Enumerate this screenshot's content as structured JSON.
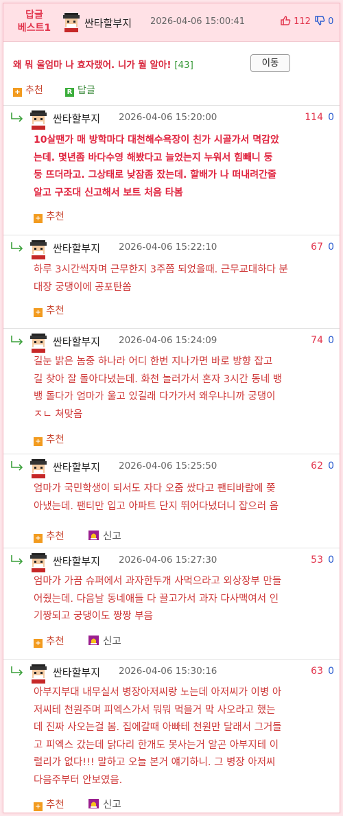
{
  "post": {
    "best_line1": "답글",
    "best_line2": "베스트1",
    "author": "싼타할부지",
    "date": "2026-04-06 15:00:41",
    "upvotes": "112",
    "downvotes": "0",
    "title": "왜 뭐 울엄마 나 효자랬어. 니가 뭘 알아!",
    "reply_count": "[43]",
    "move_button": "이동",
    "recommend_label": "추천",
    "reply_label": "답글"
  },
  "replies": [
    {
      "author": "싼타할부지",
      "date": "2026-04-06 15:20:00",
      "upvotes": "114",
      "downvotes": "0",
      "lines": [
        "10살땐가 매 방학마다 대천해수욕장이 친가 시골가서 멱감았",
        "는데. 몇년좀 바다수영 해봤다고 늘었는지 누워서 힘빼니 둥",
        "둥 뜨더라고. 그상태로 낮잠좀 잤는데. 할배가 나 떠내려간줄",
        "알고 구조대 신고해서 보트 처음 타봄"
      ],
      "recommend_label": "추천",
      "report_label": ""
    },
    {
      "author": "싼타할부지",
      "date": "2026-04-06 15:22:10",
      "upvotes": "67",
      "downvotes": "0",
      "lines": [
        "하루 3시간씩자며 근무한지 3주쯤 되었을때. 근무교대하다 분",
        "대장 궁댕이에 공포탄쏨"
      ],
      "recommend_label": "추천",
      "report_label": ""
    },
    {
      "author": "싼타할부지",
      "date": "2026-04-06 15:24:09",
      "upvotes": "74",
      "downvotes": "0",
      "lines": [
        "길눈 밝은 놈중 하나라 어디 한번 지나가면 바로 방향 잡고",
        "길 찾아 잘 돌아다녔는데. 화천 놀러가서 혼자 3시간 동네 뱅",
        "뱅 돌다가 엄마가 울고 있길래 다가가서 왜우냐니까 궁댕이",
        "ㅈㄴ 쳐맞음"
      ],
      "recommend_label": "추천",
      "report_label": ""
    },
    {
      "author": "싼타할부지",
      "date": "2026-04-06 15:25:50",
      "upvotes": "62",
      "downvotes": "0",
      "lines": [
        "엄마가 국민학생이 되서도 자다 오줌 쌌다고 팬티바람에 쫒",
        "아냈는데. 팬티만 입고 아파트 단지 뛰어다녔더니 잡으러 옴"
      ],
      "recommend_label": "추천",
      "report_label": "신고"
    },
    {
      "author": "싼타할부지",
      "date": "2026-04-06 15:27:30",
      "upvotes": "53",
      "downvotes": "0",
      "lines": [
        "엄마가 가끔 슈퍼에서 과자한두개 사먹으라고 외상장부 만들",
        "어줬는데. 다음날 동네애들 다 끌고가서 과자 다사맥여서 인",
        "기짱되고 궁댕이도 짱짱 부음"
      ],
      "recommend_label": "추천",
      "report_label": "신고"
    },
    {
      "author": "싼타할부지",
      "date": "2026-04-06 15:30:16",
      "upvotes": "63",
      "downvotes": "0",
      "lines": [
        "아부지부대 내무실서 병장아저씨랑 노는데 아저씨가 이병 아",
        "저씨테 천원주며 피엑스가서 뭐뭐 먹을거 막 사오라고 했는",
        "데 진짜 사오는걸 봄. 집에갈때 아빠테 천원만 달래서 그거들",
        "고 피엑스 갔는데 닭다리 한개도 못사는거 알곤 아부지테 이",
        "럴리가 없다!!! 말하고 오늘 본거 얘기하니. 그 병장 아저씨",
        "다음주부터 안보였음."
      ],
      "recommend_label": "추천",
      "report_label": "신고"
    }
  ]
}
